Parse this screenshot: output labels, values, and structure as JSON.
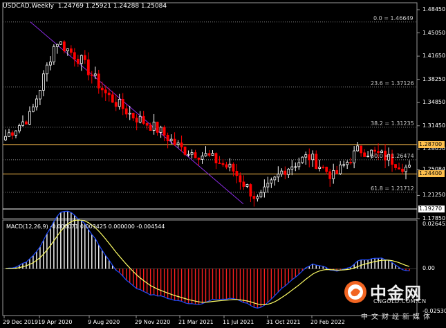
{
  "header": {
    "symbol": "USDCAD,Weekly",
    "ohlc": "1.24769 1.25921 1.24288 1.25084"
  },
  "macd": {
    "label": "MACD(12,26,9) -0.000071 0.003425 0.000000 -0.004544"
  },
  "fib_levels": [
    {
      "label": "0.0 = 1.46649",
      "price": 1.46649
    },
    {
      "label": "23.6 = 1.37126",
      "price": 1.37126
    },
    {
      "label": "38.2 = 1.31235",
      "price": 1.31235
    },
    {
      "label": "50.0 = 1.26474",
      "price": 1.26474
    },
    {
      "label": "61.8 = 1.21712",
      "price": 1.21712
    }
  ],
  "horizontal_lines": [
    {
      "label": "1.28700",
      "price": 1.287,
      "color": "#ffc04d"
    },
    {
      "label": "1.24400",
      "price": 1.244,
      "color": "#ffc04d"
    },
    {
      "label": "1.19270",
      "price": 1.1927,
      "color": "#ffffff"
    }
  ],
  "price_axis": {
    "ticks": [
      "1.48450",
      "1.45050",
      "1.41650",
      "1.38250",
      "1.34850",
      "1.31450",
      "1.28050",
      "1.25084",
      "1.21250",
      "1.17850"
    ]
  },
  "macd_axis": {
    "ticks": [
      "0.026452",
      "0.00",
      "-0.025307"
    ]
  },
  "time_axis": {
    "ticks": [
      "29 Dec 2019",
      "19 Apr 2020",
      "9 Aug 2020",
      "29 Nov 2020",
      "21 Mar 2021",
      "11 Jul 2021",
      "31 Oct 2021",
      "20 Feb 2022"
    ]
  },
  "watermark": {
    "brand_cn": "中金网",
    "domain": "CNGOLD.COM.CN",
    "tagline": "中文财经新媒体"
  },
  "colors": {
    "background": "#000000",
    "bull_candle": "#ffffff",
    "bear_candle": "#ff0000",
    "trendline": "#8a2be2",
    "support_resistance": "#ffc04d",
    "macd_signal": "#ffff66",
    "macd_line": "#1e4bff"
  },
  "chart_data": {
    "type": "candlestick",
    "instrument": "USDCAD",
    "timeframe": "Weekly",
    "price_range": [
      1.1785,
      1.4845
    ],
    "macd_range": [
      -0.025307,
      0.026452
    ],
    "trendline": {
      "from": [
        "29 Dec 2019",
        1.46649
      ],
      "to": [
        "11 Jul 2021",
        1.2
      ]
    },
    "close_path": [
      {
        "t": "29 Dec 2019",
        "v": 1.299
      },
      {
        "t": "Feb 2020",
        "v": 1.33
      },
      {
        "t": "Mar 2020",
        "v": 1.44
      },
      {
        "t": "19 Apr 2020",
        "v": 1.41
      },
      {
        "t": "Jun 2020",
        "v": 1.36
      },
      {
        "t": "9 Aug 2020",
        "v": 1.33
      },
      {
        "t": "Oct 2020",
        "v": 1.31
      },
      {
        "t": "29 Nov 2020",
        "v": 1.28
      },
      {
        "t": "Jan 2021",
        "v": 1.27
      },
      {
        "t": "21 Mar 2021",
        "v": 1.25
      },
      {
        "t": "May 2021",
        "v": 1.205
      },
      {
        "t": "11 Jul 2021",
        "v": 1.25
      },
      {
        "t": "Aug 2021",
        "v": 1.27
      },
      {
        "t": "31 Oct 2021",
        "v": 1.24
      },
      {
        "t": "Dec 2021",
        "v": 1.28
      },
      {
        "t": "20 Feb 2022",
        "v": 1.27
      },
      {
        "t": "Mar 2022",
        "v": 1.25084
      }
    ]
  }
}
